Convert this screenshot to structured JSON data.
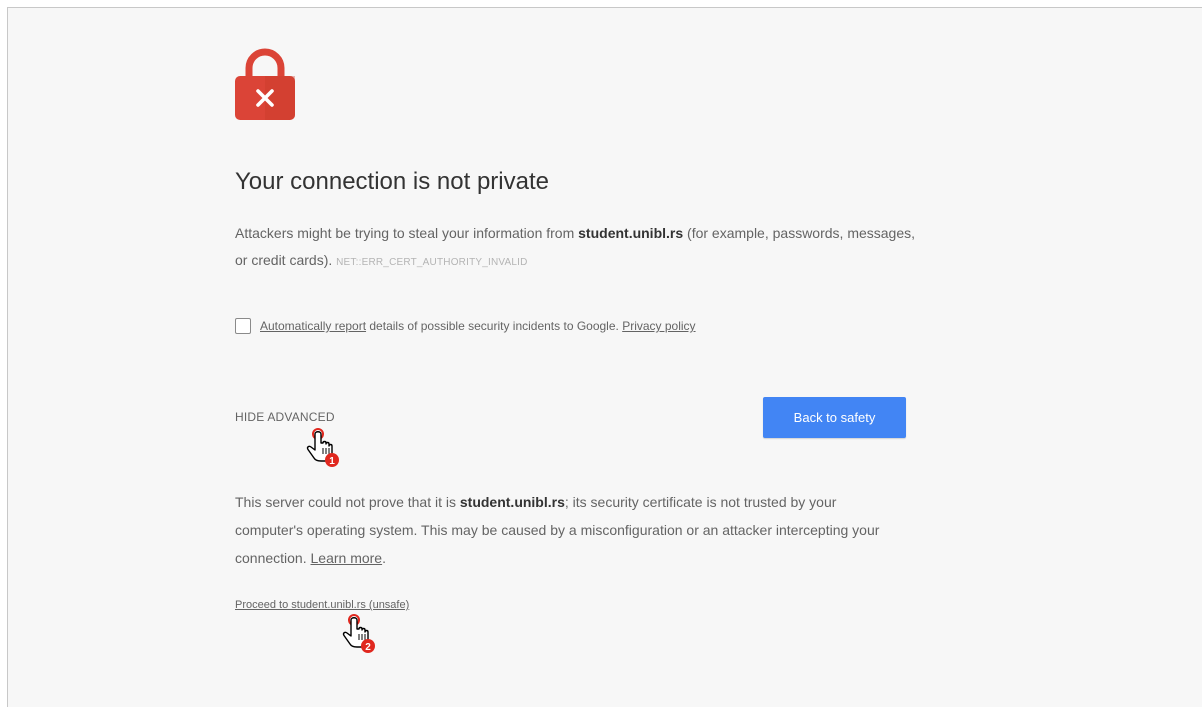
{
  "heading": "Your connection is not private",
  "intro": {
    "prefix": "Attackers might be trying to steal your information from ",
    "domain": "student.unibl.rs",
    "suffix": " (for example, passwords, messages, or credit cards). ",
    "error_code": "NET::ERR_CERT_AUTHORITY_INVALID"
  },
  "report": {
    "link": "Automatically report",
    "text": " details of possible security incidents to Google. ",
    "privacy_link": "Privacy policy",
    "checked": false
  },
  "hide_advanced": "HIDE ADVANCED",
  "back_button": "Back to safety",
  "details": {
    "prefix": "This server could not prove that it is ",
    "domain": "student.unibl.rs",
    "suffix": "; its security certificate is not trusted by your computer's operating system. This may be caused by a misconfiguration or an attacker intercepting your connection. ",
    "learn_more": "Learn more",
    "end": "."
  },
  "proceed_link": "Proceed to student.unibl.rs (unsafe)",
  "annotations": [
    {
      "number": "1"
    },
    {
      "number": "2"
    }
  ],
  "colors": {
    "lock_red": "#db4437",
    "button_blue": "#4285f4",
    "badge_red": "#e0281f"
  },
  "icons": {
    "lock": "lock-error-icon",
    "cursor": "hand-pointer-icon"
  }
}
